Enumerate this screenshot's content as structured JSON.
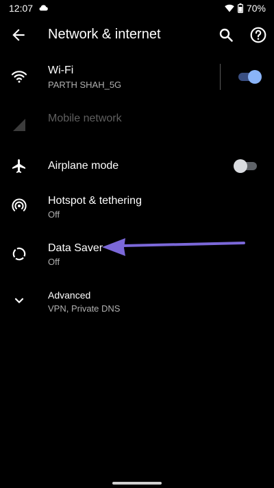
{
  "status_bar": {
    "time": "12:07",
    "battery_percent": "70%"
  },
  "toolbar": {
    "title": "Network & internet"
  },
  "items": [
    {
      "title": "Wi-Fi",
      "summary": "PARTH SHAH_5G",
      "toggle": "on"
    },
    {
      "title": "Mobile network",
      "disabled": true
    },
    {
      "title": "Airplane mode",
      "toggle": "off"
    },
    {
      "title": "Hotspot & tethering",
      "summary": "Off"
    },
    {
      "title": "Data Saver",
      "summary": "Off"
    },
    {
      "title": "Advanced",
      "summary": "VPN, Private DNS"
    }
  ],
  "icons": {
    "status": [
      "cloud-icon",
      "wifi-signal-icon",
      "battery-icon"
    ],
    "toolbar": [
      "back-arrow-icon",
      "search-icon",
      "help-icon"
    ],
    "rows": [
      "wifi-icon",
      "signal-icon",
      "airplane-icon",
      "hotspot-icon",
      "data-saver-icon",
      "chevron-down-icon"
    ]
  },
  "colors": {
    "background": "#000000",
    "accent": "#8ab4f8",
    "annotation_arrow": "#7b68d9"
  }
}
